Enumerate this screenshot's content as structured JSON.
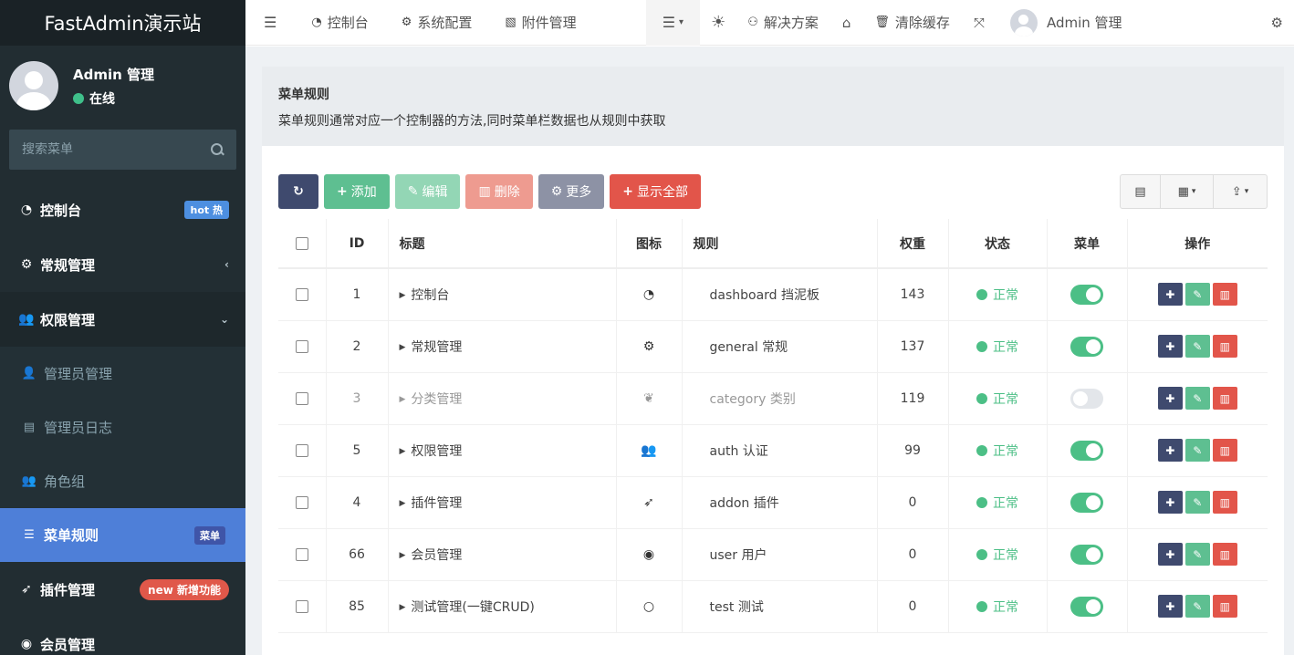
{
  "sidebar": {
    "logo": "FastAdmin演示站",
    "user": {
      "name": "Admin  管理",
      "status": "在线"
    },
    "search_placeholder": "搜索菜单",
    "items": [
      {
        "label": "控制台",
        "badge": "hot 热"
      },
      {
        "label": "常规管理"
      },
      {
        "label": "权限管理"
      },
      {
        "label": "管理员管理"
      },
      {
        "label": "管理员日志"
      },
      {
        "label": "角色组"
      },
      {
        "label": "菜单规则",
        "badge": "菜单"
      },
      {
        "label": "插件管理",
        "badge": "new 新增功能"
      },
      {
        "label": "会员管理"
      }
    ]
  },
  "topnav": {
    "dashboard": "控制台",
    "settings": "系统配置",
    "attachments": "附件管理",
    "solutions": "解决方案",
    "clear_cache": "清除缓存",
    "user": "Admin  管理"
  },
  "panel": {
    "title": "菜单规则",
    "desc": "菜单规则通常对应一个控制器的方法,同时菜单栏数据也从规则中获取"
  },
  "toolbar": {
    "add": "添加",
    "edit": "编辑",
    "delete": "删除",
    "more": "更多",
    "show_all": "显示全部"
  },
  "table": {
    "headers": [
      "ID",
      "标题",
      "图标",
      "规则",
      "权重",
      "状态",
      "菜单",
      "操作"
    ],
    "rows": [
      {
        "id": "1",
        "title": "控制台",
        "icon": "dashboard-icon",
        "rule": "dashboard  挡泥板",
        "weight": "143",
        "status": "正常",
        "menu": true
      },
      {
        "id": "2",
        "title": "常规管理",
        "icon": "cogs-icon",
        "rule": "general  常规",
        "weight": "137",
        "status": "正常",
        "menu": true
      },
      {
        "id": "3",
        "title": "分类管理",
        "icon": "leaf-icon",
        "rule": "category  类别",
        "weight": "119",
        "status": "正常",
        "menu": false
      },
      {
        "id": "5",
        "title": "权限管理",
        "icon": "group-icon",
        "rule": "auth  认证",
        "weight": "99",
        "status": "正常",
        "menu": true
      },
      {
        "id": "4",
        "title": "插件管理",
        "icon": "rocket-icon",
        "rule": "addon  插件",
        "weight": "0",
        "status": "正常",
        "menu": true
      },
      {
        "id": "66",
        "title": "会员管理",
        "icon": "user-circle-icon",
        "rule": "user  用户",
        "weight": "0",
        "status": "正常",
        "menu": true
      },
      {
        "id": "85",
        "title": "测试管理(一键CRUD)",
        "icon": "circle-o-icon",
        "rule": "test  测试",
        "weight": "0",
        "status": "正常",
        "menu": true
      }
    ]
  },
  "colors": {
    "sidebar_bg": "#222d32",
    "active_menu": "#4e7fd8",
    "success": "#5ebf91",
    "danger": "#e2554a",
    "dark_btn": "#3f4a6e"
  }
}
